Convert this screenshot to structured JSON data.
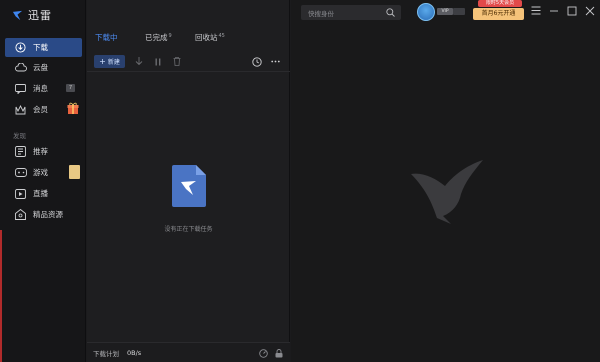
{
  "app": {
    "name": "迅雷"
  },
  "sidebar": {
    "items": [
      {
        "label": "下载",
        "icon": "download-circle-icon",
        "active": true
      },
      {
        "label": "云盘",
        "icon": "cloud-icon"
      },
      {
        "label": "消息",
        "icon": "message-icon",
        "badge": "7"
      },
      {
        "label": "会员",
        "icon": "crown-icon"
      }
    ],
    "section_label": "发现",
    "discover": [
      {
        "label": "推荐",
        "icon": "recommend-icon"
      },
      {
        "label": "游戏",
        "icon": "gamepad-icon"
      },
      {
        "label": "直播",
        "icon": "live-icon"
      },
      {
        "label": "精品资源",
        "icon": "resources-icon"
      }
    ]
  },
  "tabs": [
    {
      "label": "下载中",
      "count": "",
      "active": true
    },
    {
      "label": "已完成",
      "count": "9"
    },
    {
      "label": "回收站",
      "count": "45"
    }
  ],
  "toolbar": {
    "new_label": "新建"
  },
  "empty": {
    "message": "没有正在下载任务"
  },
  "footer": {
    "plan_label": "下载计划",
    "speed": "0B/s"
  },
  "header": {
    "search_placeholder": "快搜身份",
    "vip_label": "VIP",
    "promo_tag": "限时5天会员",
    "promo_button": "首月6元开通"
  },
  "colors": {
    "accent": "#4d8df5",
    "active_nav": "#2a4a87",
    "promo": "#f5c37a"
  }
}
